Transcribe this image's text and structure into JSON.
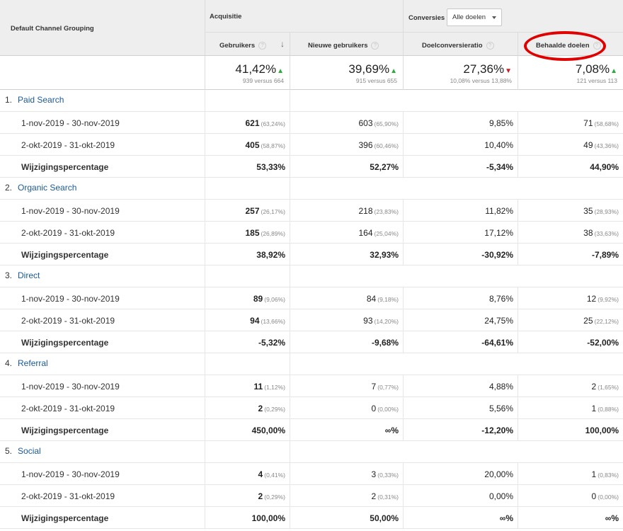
{
  "header": {
    "dimension_label": "Default Channel Grouping",
    "group_acquisition": "Acquisitie",
    "group_conversions": "Conversies",
    "goal_dropdown": "Alle doelen",
    "columns": [
      "Gebruikers",
      "Nieuwe gebruikers",
      "Doelconversieratio",
      "Behaalde doelen"
    ],
    "help_glyph": "?",
    "sort_glyph": "↓"
  },
  "totals": [
    {
      "value": "41,42%",
      "trend": "up",
      "compare": "939 versus 664"
    },
    {
      "value": "39,69%",
      "trend": "up",
      "compare": "915 versus 655"
    },
    {
      "value": "27,36%",
      "trend": "down",
      "compare": "10,08% versus 13,88%"
    },
    {
      "value": "7,08%",
      "trend": "up",
      "compare": "121 versus 113"
    }
  ],
  "trend_glyphs": {
    "up": "▲",
    "down": "▼"
  },
  "colors": {
    "up": "#2cac3c",
    "down": "#d01c1c",
    "link": "#1a5a96",
    "highlight": "#e00000"
  },
  "channels": [
    {
      "index": "1.",
      "name": "Paid Search",
      "rows": [
        {
          "label": "1-nov-2019 - 30-nov-2019",
          "cells": [
            [
              "621",
              "(63,24%)"
            ],
            [
              "603",
              "(65,90%)"
            ],
            [
              "9,85%",
              ""
            ],
            [
              "71",
              "(58,68%)"
            ]
          ]
        },
        {
          "label": "2-okt-2019 - 31-okt-2019",
          "cells": [
            [
              "405",
              "(58,87%)"
            ],
            [
              "396",
              "(60,46%)"
            ],
            [
              "10,40%",
              ""
            ],
            [
              "49",
              "(43,36%)"
            ]
          ]
        }
      ],
      "change": {
        "label": "Wijzigingspercentage",
        "cells": [
          "53,33%",
          "52,27%",
          "-5,34%",
          "44,90%"
        ]
      }
    },
    {
      "index": "2.",
      "name": "Organic Search",
      "rows": [
        {
          "label": "1-nov-2019 - 30-nov-2019",
          "cells": [
            [
              "257",
              "(26,17%)"
            ],
            [
              "218",
              "(23,83%)"
            ],
            [
              "11,82%",
              ""
            ],
            [
              "35",
              "(28,93%)"
            ]
          ]
        },
        {
          "label": "2-okt-2019 - 31-okt-2019",
          "cells": [
            [
              "185",
              "(26,89%)"
            ],
            [
              "164",
              "(25,04%)"
            ],
            [
              "17,12%",
              ""
            ],
            [
              "38",
              "(33,63%)"
            ]
          ]
        }
      ],
      "change": {
        "label": "Wijzigingspercentage",
        "cells": [
          "38,92%",
          "32,93%",
          "-30,92%",
          "-7,89%"
        ]
      }
    },
    {
      "index": "3.",
      "name": "Direct",
      "rows": [
        {
          "label": "1-nov-2019 - 30-nov-2019",
          "cells": [
            [
              "89",
              "(9,06%)"
            ],
            [
              "84",
              "(9,18%)"
            ],
            [
              "8,76%",
              ""
            ],
            [
              "12",
              "(9,92%)"
            ]
          ]
        },
        {
          "label": "2-okt-2019 - 31-okt-2019",
          "cells": [
            [
              "94",
              "(13,66%)"
            ],
            [
              "93",
              "(14,20%)"
            ],
            [
              "24,75%",
              ""
            ],
            [
              "25",
              "(22,12%)"
            ]
          ]
        }
      ],
      "change": {
        "label": "Wijzigingspercentage",
        "cells": [
          "-5,32%",
          "-9,68%",
          "-64,61%",
          "-52,00%"
        ]
      }
    },
    {
      "index": "4.",
      "name": "Referral",
      "rows": [
        {
          "label": "1-nov-2019 - 30-nov-2019",
          "cells": [
            [
              "11",
              "(1,12%)"
            ],
            [
              "7",
              "(0,77%)"
            ],
            [
              "4,88%",
              ""
            ],
            [
              "2",
              "(1,65%)"
            ]
          ]
        },
        {
          "label": "2-okt-2019 - 31-okt-2019",
          "cells": [
            [
              "2",
              "(0,29%)"
            ],
            [
              "0",
              "(0,00%)"
            ],
            [
              "5,56%",
              ""
            ],
            [
              "1",
              "(0,88%)"
            ]
          ]
        }
      ],
      "change": {
        "label": "Wijzigingspercentage",
        "cells": [
          "450,00%",
          "∞%",
          "-12,20%",
          "100,00%"
        ]
      }
    },
    {
      "index": "5.",
      "name": "Social",
      "rows": [
        {
          "label": "1-nov-2019 - 30-nov-2019",
          "cells": [
            [
              "4",
              "(0,41%)"
            ],
            [
              "3",
              "(0,33%)"
            ],
            [
              "20,00%",
              ""
            ],
            [
              "1",
              "(0,83%)"
            ]
          ]
        },
        {
          "label": "2-okt-2019 - 31-okt-2019",
          "cells": [
            [
              "2",
              "(0,29%)"
            ],
            [
              "2",
              "(0,31%)"
            ],
            [
              "0,00%",
              ""
            ],
            [
              "0",
              "(0,00%)"
            ]
          ]
        }
      ],
      "change": {
        "label": "Wijzigingspercentage",
        "cells": [
          "100,00%",
          "50,00%",
          "∞%",
          "∞%"
        ]
      }
    }
  ]
}
